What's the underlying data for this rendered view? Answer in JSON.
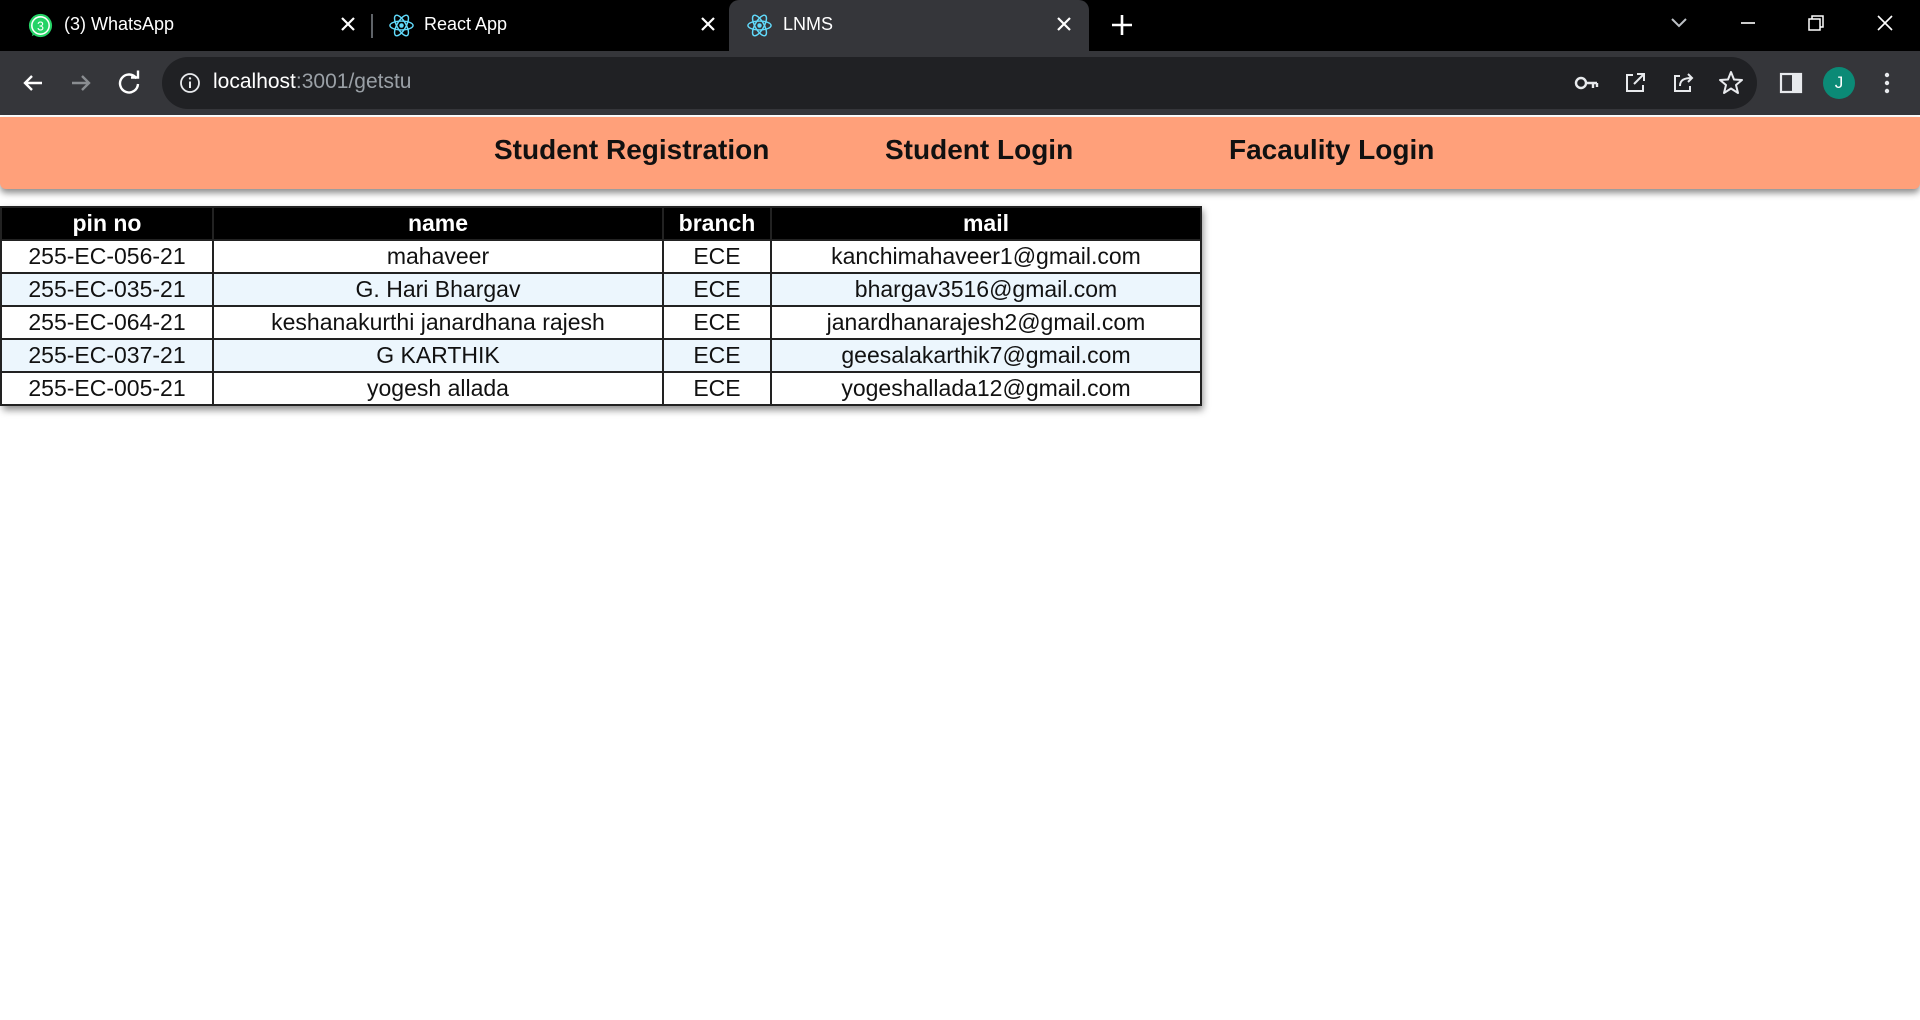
{
  "browser": {
    "tabs": [
      {
        "title": "(3) WhatsApp",
        "badge": "3",
        "favicon": "whatsapp-icon",
        "active": false
      },
      {
        "title": "React App",
        "favicon": "react-icon",
        "active": false
      },
      {
        "title": "LNMS",
        "favicon": "react-icon",
        "active": true
      }
    ],
    "url_host": "localhost",
    "url_path": ":3001/getstu",
    "profile_initial": "J",
    "colors": {
      "tabstrip": "#000000",
      "toolbar": "#35363a",
      "omnibox": "#202124",
      "avatar": "#0b8a76"
    }
  },
  "app_nav": {
    "links": [
      "Student Registration",
      "Student Login",
      "Facaulity Login"
    ],
    "background": "#ffa07a"
  },
  "students_table": {
    "headers": [
      "pin no",
      "name",
      "branch",
      "mail"
    ],
    "rows": [
      [
        "255-EC-056-21",
        "mahaveer",
        "ECE",
        "kanchimahaveer1@gmail.com"
      ],
      [
        "255-EC-035-21",
        "G. Hari Bhargav",
        "ECE",
        "bhargav3516@gmail.com"
      ],
      [
        "255-EC-064-21",
        "keshanakurthi janardhana rajesh",
        "ECE",
        "janardhanarajesh2@gmail.com"
      ],
      [
        "255-EC-037-21",
        "G KARTHIK",
        "ECE",
        "geesalakarthik7@gmail.com"
      ],
      [
        "255-EC-005-21",
        "yogesh allada",
        "ECE",
        "yogeshallada12@gmail.com"
      ]
    ],
    "colors": {
      "header_bg": "#000000",
      "alt_row_bg": "#ecf6fd"
    }
  }
}
